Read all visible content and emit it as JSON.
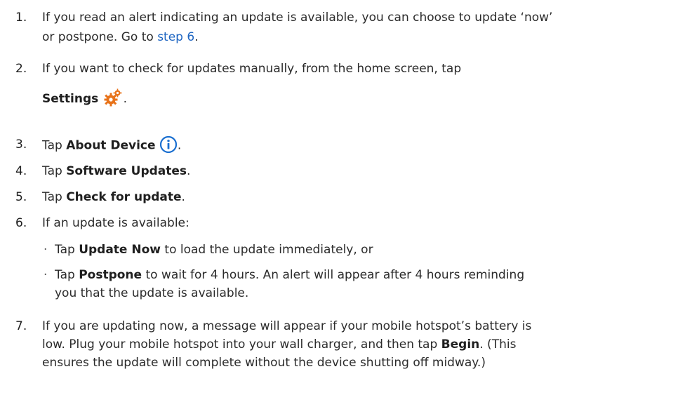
{
  "steps": [
    {
      "num": "1.",
      "line1": "If you read an alert indicating an update is available, you can choose to update ‘now’",
      "line2_pre": "or postpone. Go to ",
      "link": "step 6",
      "line2_post": "."
    },
    {
      "num": "2.",
      "line1": "If you want to check for updates manually, from the home screen, tap",
      "bold": "Settings",
      "icon": "gear-icon",
      "post": "."
    },
    {
      "num": "3.",
      "pre": "Tap ",
      "bold": "About Device",
      "icon": "info-icon",
      "post": "."
    },
    {
      "num": "4.",
      "pre": "Tap ",
      "bold": "Software Updates",
      "post": "."
    },
    {
      "num": "5.",
      "pre": "Tap ",
      "bold": "Check for update",
      "post": "."
    },
    {
      "num": "6.",
      "text": "If an update is available:",
      "sub": [
        {
          "bullet": "·",
          "pre": "Tap ",
          "bold": "Update Now",
          "post": " to load the update immediately, or"
        },
        {
          "bullet": "·",
          "pre": "Tap ",
          "bold": "Postpone",
          "post": " to wait for 4 hours. An alert will appear after 4 hours reminding",
          "line2": "you that the update is available."
        }
      ]
    },
    {
      "num": "7.",
      "line1": "If you are updating now, a message will appear if your mobile hotspot’s battery is",
      "line2_pre": "low. Plug your mobile hotspot into your wall charger, and then tap ",
      "bold": "Begin",
      "line2_post": ". (This",
      "line3": "ensures the update will complete without the device shutting off midway.)"
    }
  ],
  "colors": {
    "text": "#2b2b2b",
    "link": "#1f66c2",
    "gear": "#e8731a",
    "info": "#1a6fd0"
  }
}
